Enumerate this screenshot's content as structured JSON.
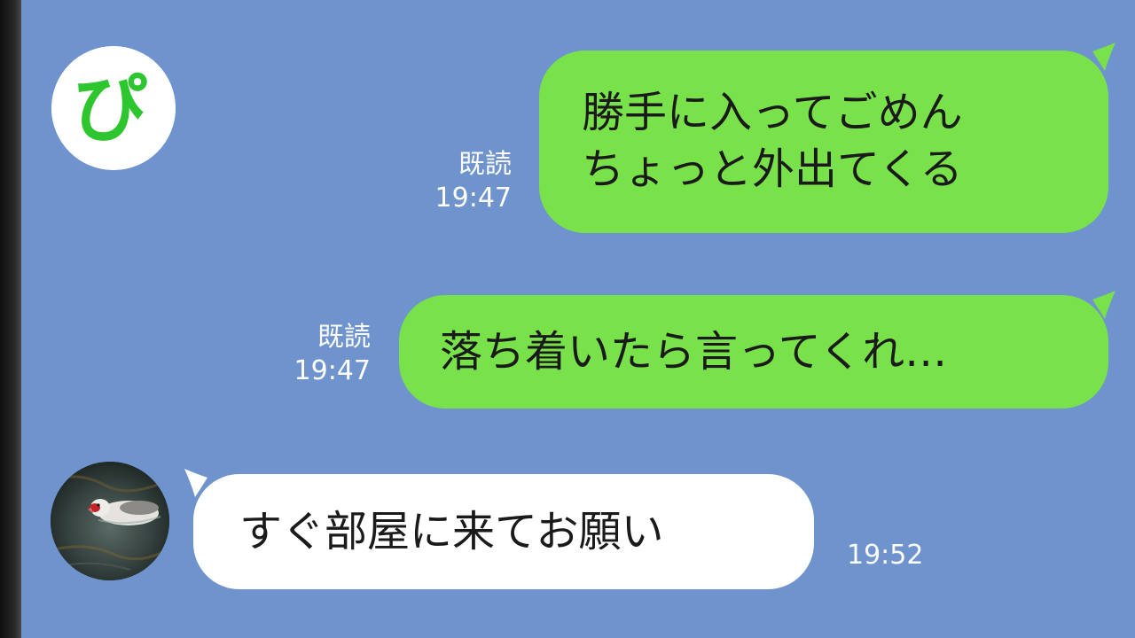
{
  "chat": {
    "messages": [
      {
        "side": "sent",
        "lines": [
          "勝手に入ってごめん",
          "ちょっと外出てくる"
        ],
        "read_label": "既読",
        "time": "19:47"
      },
      {
        "side": "sent",
        "lines": [
          "落ち着いたら言ってくれ…"
        ],
        "read_label": "既読",
        "time": "19:47"
      },
      {
        "side": "received",
        "lines": [
          "すぐ部屋に来てお願い"
        ],
        "time": "19:52"
      }
    ]
  },
  "avatars": {
    "top": {
      "glyph": "ぴ",
      "icon": "pi-logo-icon"
    },
    "bottom": {
      "icon": "duck-photo-avatar"
    }
  },
  "colors": {
    "background": "#6f94cd",
    "sent_bubble": "#79e24a",
    "received_bubble": "#ffffff",
    "logo_green": "#2ec62e"
  }
}
